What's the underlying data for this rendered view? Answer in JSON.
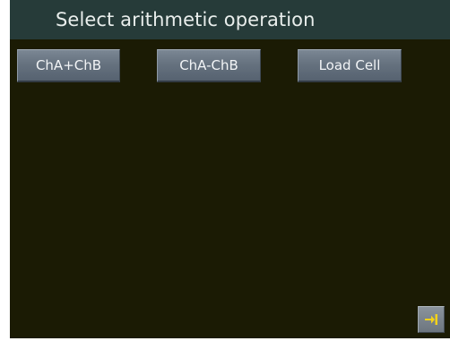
{
  "header": {
    "title": "Select arithmetic operation"
  },
  "operations": [
    {
      "label": "ChA+ChB"
    },
    {
      "label": "ChA-ChB"
    },
    {
      "label": "Load Cell"
    }
  ],
  "exit_button": {
    "icon": "exit-arrow-icon"
  },
  "colors": {
    "screen_background": "#1b1b04",
    "title_bar": "#263b39",
    "button": "#6a7683",
    "exit_icon": "#f2d21a"
  }
}
